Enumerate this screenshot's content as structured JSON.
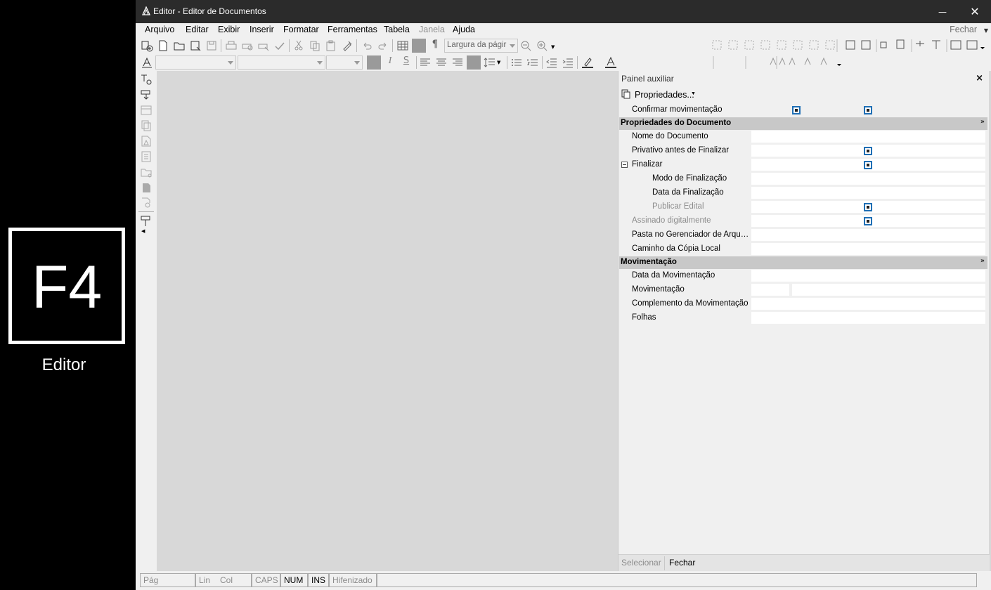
{
  "branding": {
    "logo_text": "F4",
    "caption": "Editor"
  },
  "window": {
    "title": "Editor - Editor de Documentos",
    "minimize": "—",
    "close": "✕"
  },
  "menu": {
    "items": [
      "Arquivo",
      "Editar",
      "Exibir",
      "Inserir",
      "Formatar",
      "Ferramentas",
      "Tabela",
      "Janela",
      "Ajuda"
    ],
    "right_label": "Fechar"
  },
  "toolbar": {
    "zoom_combo": "Largura da págir",
    "pilcrow": "¶",
    "italic": "I",
    "strike": "S"
  },
  "panel": {
    "title": "Painel auxiliar",
    "close": "×",
    "properties_button": "Propriedades...",
    "top_row": "Confirmar movimentação",
    "sections": [
      {
        "title": "Propriedades do Documento"
      },
      {
        "title": "Movimentação"
      }
    ],
    "rows": {
      "nome": "Nome do Documento",
      "privativo": "Privativo antes de Finalizar",
      "finalizar": "Finalizar",
      "modo": "Modo de Finalização",
      "data_fin": "Data da Finalização",
      "publicar": "Publicar Edital",
      "assinado": "Assinado digitalmente",
      "pasta": "Pasta no Gerenciador de Arquiv...",
      "caminho": "Caminho da Cópia Local",
      "data_mov": "Data da Movimentação",
      "mov": "Movimentação",
      "complemento": "Complemento da Movimentação",
      "folhas": "Folhas"
    },
    "footer": {
      "select": "Selecionar",
      "close": "Fechar"
    }
  },
  "status": {
    "pag": "Pág",
    "lin": "Lin",
    "col": "Col",
    "caps": "CAPS",
    "num": "NUM",
    "ins": "INS",
    "hifen": "Hifenizado"
  }
}
